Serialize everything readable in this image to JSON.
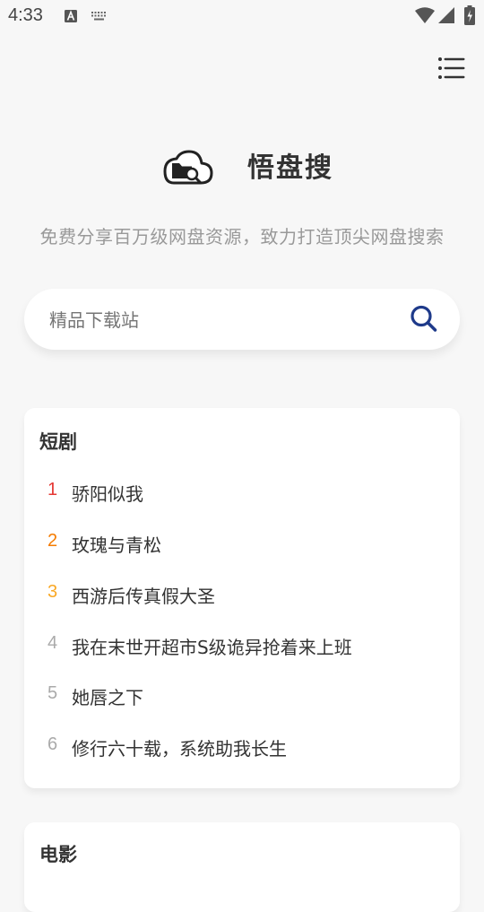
{
  "status_bar": {
    "time": "4:33",
    "icons": [
      "text-a-icon",
      "keyboard-icon",
      "wifi-icon",
      "signal-icon",
      "battery-icon"
    ]
  },
  "header": {
    "menu_icon": "list-menu-icon"
  },
  "brand": {
    "logo_icon": "cloud-folder-search-icon",
    "name": "悟盘搜",
    "tagline": "免费分享百万级网盘资源，致力打造顶尖网盘搜索"
  },
  "search": {
    "value": "",
    "placeholder": "精品下载站",
    "icon": "search-icon",
    "icon_color": "#1e3a8a"
  },
  "colors": {
    "rank_1": "#e53935",
    "rank_2": "#f57c00",
    "rank_3": "#f9a825",
    "rank_other": "#aaaaaa"
  },
  "sections": [
    {
      "title": "短剧",
      "items": [
        {
          "rank": "1",
          "title": "骄阳似我"
        },
        {
          "rank": "2",
          "title": "玫瑰与青松"
        },
        {
          "rank": "3",
          "title": "西游后传真假大圣"
        },
        {
          "rank": "4",
          "title": "我在末世开超市S级诡异抢着来上班"
        },
        {
          "rank": "5",
          "title": "她唇之下"
        },
        {
          "rank": "6",
          "title": "修行六十载，系统助我长生"
        }
      ]
    },
    {
      "title": "电影",
      "items": []
    }
  ]
}
